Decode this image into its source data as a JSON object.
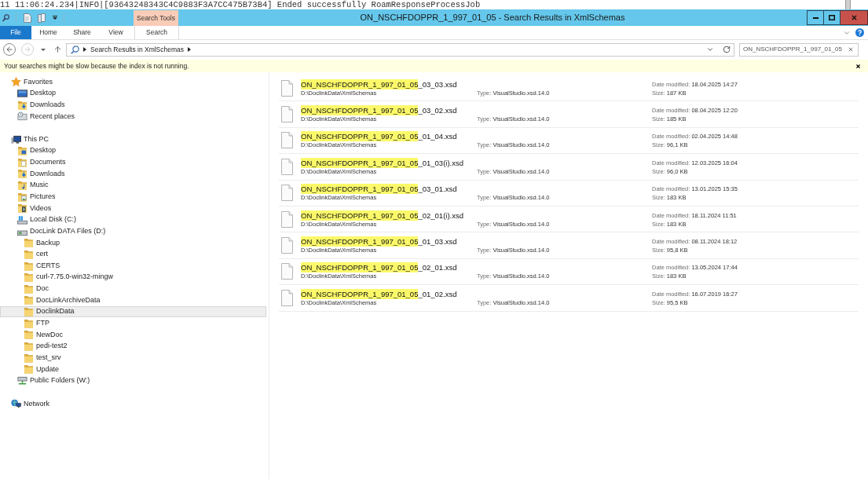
{
  "background": {
    "log_line": "11 11:06:24.234|INFO|[93643248343C4C9883F3A7CC475B73B4] Ended successfully RoamResponseProcessJob"
  },
  "window": {
    "title": "ON_NSCHFDOPPR_1_997_01_05 - Search Results in XmlSchemas",
    "context_group": "Search Tools"
  },
  "ribbon_tabs": [
    {
      "label": "File",
      "kind": "file",
      "selected": false
    },
    {
      "label": "Home",
      "kind": "tab",
      "selected": false
    },
    {
      "label": "Share",
      "kind": "tab",
      "selected": false
    },
    {
      "label": "View",
      "kind": "tab",
      "selected": false
    },
    {
      "label": "Search",
      "kind": "context",
      "selected": false
    }
  ],
  "nav_buttons": [
    {
      "kind": "back",
      "disabled": false
    },
    {
      "kind": "forward",
      "disabled": true
    },
    {
      "kind": "recent",
      "disabled": false
    },
    {
      "kind": "up",
      "disabled": false
    }
  ],
  "address_bar": {
    "location": "Search Results in XmlSchemas"
  },
  "search_box": {
    "value": "ON_NSCHFDOPPR_1_997_01_05"
  },
  "info_bar": {
    "message": "Your searches might be slow because the index is not running."
  },
  "sidebar": {
    "items": [
      {
        "label": "Favorites",
        "kind": "favorites",
        "selected": false,
        "children": [
          {
            "label": "Desktop",
            "kind": "desktop",
            "selected": false
          },
          {
            "label": "Downloads",
            "kind": "downloads",
            "selected": false
          },
          {
            "label": "Recent places",
            "kind": "recent",
            "selected": false
          }
        ]
      },
      {
        "label": "This PC",
        "kind": "pc",
        "selected": false,
        "children": [
          {
            "label": "Desktop",
            "kind": "desktop_folder",
            "selected": false
          },
          {
            "label": "Documents",
            "kind": "documents",
            "selected": false
          },
          {
            "label": "Downloads",
            "kind": "downloads",
            "selected": false
          },
          {
            "label": "Music",
            "kind": "music",
            "selected": false
          },
          {
            "label": "Pictures",
            "kind": "pictures",
            "selected": false
          },
          {
            "label": "Videos",
            "kind": "videos",
            "selected": false
          },
          {
            "label": "Local Disk (C:)",
            "kind": "system_disk",
            "selected": false
          },
          {
            "label": "DocLink DATA Files (D:)",
            "kind": "disk",
            "selected": false,
            "children": [
              {
                "label": "Backup",
                "kind": "folder",
                "selected": false
              },
              {
                "label": "cert",
                "kind": "folder",
                "selected": false
              },
              {
                "label": "CERTS",
                "kind": "folder",
                "selected": false
              },
              {
                "label": "curl-7.75.0-win32-mingw",
                "kind": "folder",
                "selected": false
              },
              {
                "label": "Doc",
                "kind": "folder",
                "selected": false
              },
              {
                "label": "DocLinkArchiveData",
                "kind": "folder",
                "selected": false
              },
              {
                "label": "DoclinkData",
                "kind": "folder",
                "selected": true
              },
              {
                "label": "FTP",
                "kind": "folder",
                "selected": false
              },
              {
                "label": "NewDoc",
                "kind": "folder",
                "selected": false
              },
              {
                "label": "pedi-test2",
                "kind": "folder",
                "selected": false
              },
              {
                "label": "test_srv",
                "kind": "folder",
                "selected": false
              },
              {
                "label": "Update",
                "kind": "folder",
                "selected": false
              }
            ]
          },
          {
            "label": "Public Folders (W:)",
            "kind": "network_drive",
            "selected": false
          }
        ]
      },
      {
        "label": "Network",
        "kind": "network",
        "selected": false
      }
    ]
  },
  "results": [
    {
      "name_match": "ON_NSCHFDOPPR_1_997_01_05",
      "name_rest": "_03_03.xsd",
      "path": "D:\\DoclinkData\\XmlSchemas",
      "type_label": "Type:",
      "type": "VisualStudio.xsd.14.0",
      "date_label": "Date modified:",
      "date": "18.04.2025 14:27",
      "size_label": "Size:",
      "size": "187 KB"
    },
    {
      "name_match": "ON_NSCHFDOPPR_1_997_01_05",
      "name_rest": "_03_02.xsd",
      "path": "D:\\DoclinkData\\XmlSchemas",
      "type_label": "Type:",
      "type": "VisualStudio.xsd.14.0",
      "date_label": "Date modified:",
      "date": "08.04.2025 12:20",
      "size_label": "Size:",
      "size": "185 KB"
    },
    {
      "name_match": "ON_NSCHFDOPPR_1_997_01_05",
      "name_rest": "_01_04.xsd",
      "path": "D:\\DoclinkData\\XmlSchemas",
      "type_label": "Type:",
      "type": "VisualStudio.xsd.14.0",
      "date_label": "Date modified:",
      "date": "02.04.2025 14:48",
      "size_label": "Size:",
      "size": "96,1 KB"
    },
    {
      "name_match": "ON_NSCHFDOPPR_1_997_01_05",
      "name_rest": "_01_03(i).xsd",
      "path": "D:\\DoclinkData\\XmlSchemas",
      "type_label": "Type:",
      "type": "VisualStudio.xsd.14.0",
      "date_label": "Date modified:",
      "date": "12.03.2025 16:04",
      "size_label": "Size:",
      "size": "96,0 KB"
    },
    {
      "name_match": "ON_NSCHFDOPPR_1_997_01_05",
      "name_rest": "_03_01.xsd",
      "path": "D:\\DoclinkData\\XmlSchemas",
      "type_label": "Type:",
      "type": "VisualStudio.xsd.14.0",
      "date_label": "Date modified:",
      "date": "13.01.2025 15:35",
      "size_label": "Size:",
      "size": "183 KB"
    },
    {
      "name_match": "ON_NSCHFDOPPR_1_997_01_05",
      "name_rest": "_02_01(i).xsd",
      "path": "D:\\DoclinkData\\XmlSchemas",
      "type_label": "Type:",
      "type": "VisualStudio.xsd.14.0",
      "date_label": "Date modified:",
      "date": "18.11.2024 11:51",
      "size_label": "Size:",
      "size": "183 KB"
    },
    {
      "name_match": "ON_NSCHFDOPPR_1_997_01_05",
      "name_rest": "_01_03.xsd",
      "path": "D:\\DoclinkData\\XmlSchemas",
      "type_label": "Type:",
      "type": "VisualStudio.xsd.14.0",
      "date_label": "Date modified:",
      "date": "08.11.2024 18:12",
      "size_label": "Size:",
      "size": "95,8 KB"
    },
    {
      "name_match": "ON_NSCHFDOPPR_1_997_01_05",
      "name_rest": "_02_01.xsd",
      "path": "D:\\DoclinkData\\XmlSchemas",
      "type_label": "Type:",
      "type": "VisualStudio.xsd.14.0",
      "date_label": "Date modified:",
      "date": "13.05.2024 17:44",
      "size_label": "Size:",
      "size": "183 KB"
    },
    {
      "name_match": "ON_NSCHFDOPPR_1_997_01_05",
      "name_rest": "_01_02.xsd",
      "path": "D:\\DoclinkData\\XmlSchemas",
      "type_label": "Type:",
      "type": "VisualStudio.xsd.14.0",
      "date_label": "Date modified:",
      "date": "16.07.2019 16:27",
      "size_label": "Size:",
      "size": "95,5 KB"
    }
  ]
}
